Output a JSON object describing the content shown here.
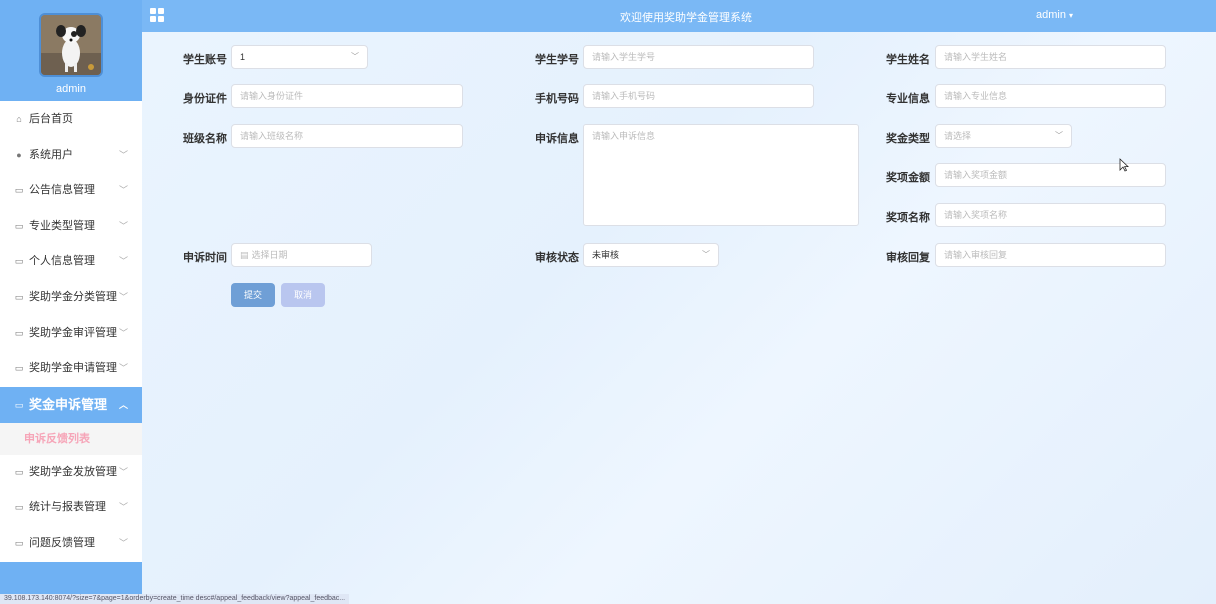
{
  "header": {
    "title": "欢迎使用奖助学金管理系统",
    "user": "admin"
  },
  "sidebar": {
    "profile_name": "admin",
    "items": [
      {
        "label": "后台首页",
        "icon": "home-icon",
        "has_sub": false
      },
      {
        "label": "系统用户",
        "icon": "user-icon",
        "has_sub": true
      },
      {
        "label": "公告信息管理",
        "icon": "folder-icon",
        "has_sub": true
      },
      {
        "label": "专业类型管理",
        "icon": "folder-icon",
        "has_sub": true
      },
      {
        "label": "个人信息管理",
        "icon": "folder-icon",
        "has_sub": true
      },
      {
        "label": "奖助学金分类管理",
        "icon": "folder-icon",
        "has_sub": true
      },
      {
        "label": "奖助学金审评管理",
        "icon": "folder-icon",
        "has_sub": true
      },
      {
        "label": "奖助学金申请管理",
        "icon": "folder-icon",
        "has_sub": true
      },
      {
        "label": "奖金申诉管理",
        "icon": "folder-icon",
        "has_sub": true,
        "active": true
      },
      {
        "label": "奖助学金发放管理",
        "icon": "folder-icon",
        "has_sub": true
      },
      {
        "label": "统计与报表管理",
        "icon": "folder-icon",
        "has_sub": true
      },
      {
        "label": "问题反馈管理",
        "icon": "folder-icon",
        "has_sub": true
      }
    ],
    "active_submenu": "申诉反馈列表"
  },
  "form": {
    "student_account": {
      "label": "学生账号",
      "value": "1"
    },
    "student_no": {
      "label": "学生学号",
      "placeholder": "请输入学生学号"
    },
    "student_name": {
      "label": "学生姓名",
      "placeholder": "请输入学生姓名"
    },
    "id_card": {
      "label": "身份证件",
      "placeholder": "请输入身份证件"
    },
    "phone": {
      "label": "手机号码",
      "placeholder": "请输入手机号码"
    },
    "major": {
      "label": "专业信息",
      "placeholder": "请输入专业信息"
    },
    "class_name": {
      "label": "班级名称",
      "placeholder": "请输入班级名称"
    },
    "appeal_info": {
      "label": "申诉信息",
      "placeholder": "请输入申诉信息"
    },
    "award_type": {
      "label": "奖金类型",
      "placeholder": "请选择"
    },
    "award_amount": {
      "label": "奖项金额",
      "placeholder": "请输入奖项金额"
    },
    "award_name": {
      "label": "奖项名称",
      "placeholder": "请输入奖项名称"
    },
    "appeal_time": {
      "label": "申诉时间",
      "placeholder": "选择日期"
    },
    "review_status": {
      "label": "审核状态",
      "value": "未审核"
    },
    "review_reply": {
      "label": "审核回复",
      "placeholder": "请输入审核回复"
    },
    "submit_label": "提交",
    "cancel_label": "取消"
  },
  "statusbar": {
    "url": "39.108.173.140:8074/?size=7&page=1&orderby=create_time desc#/appeal_feedback/view?appeal_feedbac..."
  }
}
